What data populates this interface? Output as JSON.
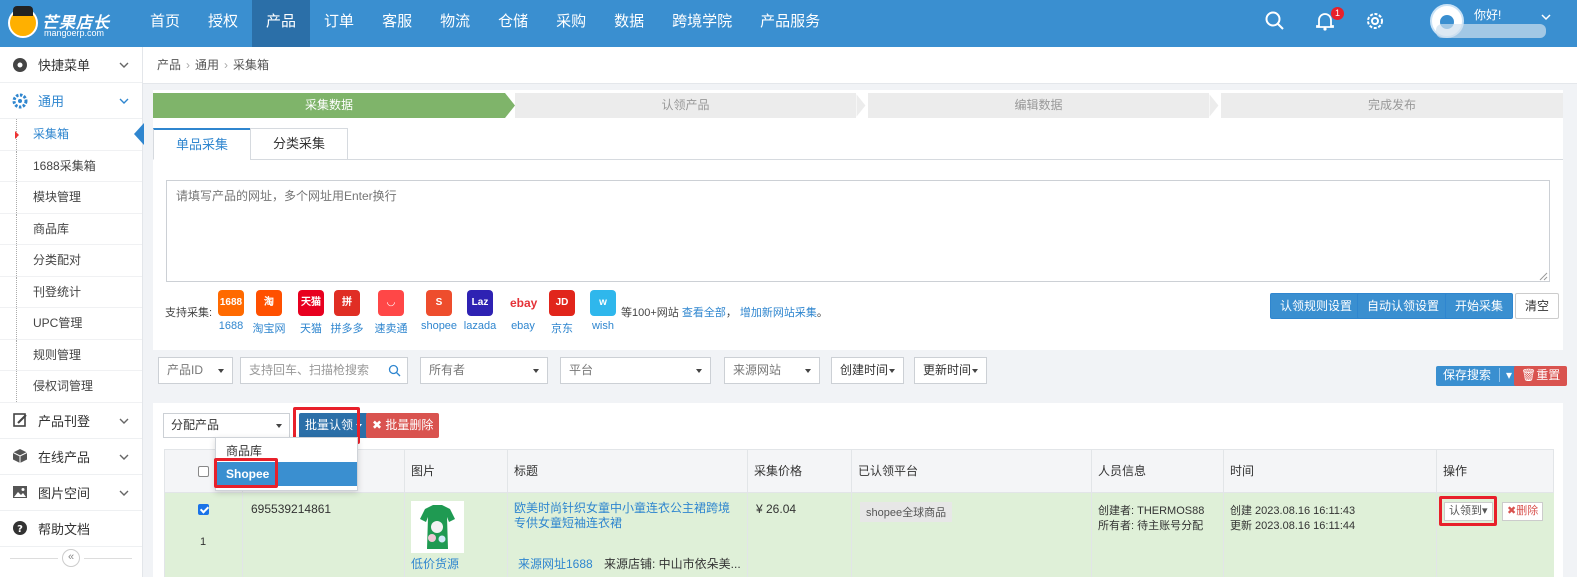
{
  "brand": {
    "name": "芒果店长",
    "domain": "mangoerp.com"
  },
  "nav": [
    {
      "label": "首页",
      "active": false
    },
    {
      "label": "授权",
      "active": false
    },
    {
      "label": "产品",
      "active": true
    },
    {
      "label": "订单",
      "active": false
    },
    {
      "label": "客服",
      "active": false
    },
    {
      "label": "物流",
      "active": false
    },
    {
      "label": "仓储",
      "active": false
    },
    {
      "label": "采购",
      "active": false
    },
    {
      "label": "数据",
      "active": false
    },
    {
      "label": "跨境学院",
      "active": false
    },
    {
      "label": "产品服务",
      "active": false
    }
  ],
  "header": {
    "notification_count": "1",
    "greeting": "你好!"
  },
  "sidebar": {
    "sections_top": [
      {
        "label": "快捷菜单",
        "icon": "compass-icon"
      },
      {
        "label": "通用",
        "icon": "gear-icon"
      }
    ],
    "sub_items": [
      "采集箱",
      "1688采集箱",
      "模块管理",
      "商品库",
      "分类配对",
      "刊登统计",
      "UPC管理",
      "规则管理",
      "侵权词管理"
    ],
    "sections_bottom": [
      {
        "label": "产品刊登",
        "icon": "edit-icon"
      },
      {
        "label": "在线产品",
        "icon": "box-icon"
      },
      {
        "label": "图片空间",
        "icon": "image-icon"
      },
      {
        "label": "帮助文档",
        "icon": "help-icon"
      }
    ],
    "collapse_glyph": "«"
  },
  "breadcrumb": [
    "产品",
    "通用",
    "采集箱"
  ],
  "steps": [
    "采集数据",
    "认领产品",
    "编辑数据",
    "完成发布"
  ],
  "tabs": [
    "单品采集",
    "分类采集"
  ],
  "collect": {
    "placeholder": "请填写产品的网址，多个网址用Enter换行",
    "support_label": "支持采集:",
    "sites": [
      {
        "label": "1688",
        "color": "#ff6a00",
        "glyph": "1688"
      },
      {
        "label": "淘宝网",
        "color": "#ff5000",
        "glyph": "淘"
      },
      {
        "label": "天猫",
        "color": "#e8001f",
        "glyph": "天猫"
      },
      {
        "label": "拼多多",
        "color": "#e02e24",
        "glyph": "拼"
      },
      {
        "label": "速卖通",
        "color": "#ff4747",
        "glyph": "◡"
      },
      {
        "label": "shopee",
        "color": "#ee4d2d",
        "glyph": "S"
      },
      {
        "label": "lazada",
        "color": "#2e22b3",
        "glyph": "Laz"
      },
      {
        "label": "ebay",
        "color": "#ffffff",
        "glyph": "ebay"
      },
      {
        "label": "京东",
        "color": "#e1251b",
        "glyph": "JD"
      },
      {
        "label": "wish",
        "color": "#2fb7ec",
        "glyph": "w"
      }
    ],
    "more_text": "等100+网站",
    "view_all": "查看全部",
    "sep": "，",
    "add_site": "增加新网站采集",
    "end": "。",
    "buttons": {
      "rules": "认领规则设置",
      "auto": "自动认领设置",
      "start": "开始采集",
      "clear": "清空"
    }
  },
  "filters": {
    "product_id": "产品ID",
    "search_placeholder": "支持回车、扫描枪搜索",
    "owner": "所有者",
    "platform": "平台",
    "source": "来源网站",
    "created": "创建时间",
    "updated": "更新时间",
    "save_search": "保存搜索",
    "reset": "重置"
  },
  "actions": {
    "assign": "分配产品",
    "batch_claim": "批量认领",
    "batch_delete": "批量删除",
    "dropdown": [
      "商品库",
      "Shopee"
    ]
  },
  "table": {
    "headers": [
      "图片",
      "标题",
      "采集价格",
      "已认领平台",
      "人员信息",
      "时间",
      "操作"
    ],
    "row": {
      "checked": true,
      "index": "1",
      "id": "695539214861",
      "image_caption": "低价货源",
      "title": "欧美时尚针织女童中小童连衣公主裙跨境专供女童短袖连衣裙",
      "source_link": "来源网址1688",
      "store": "来源店铺: 中山市依朵美...",
      "price": "¥ 26.04",
      "claimed_platform": "shopee全球商品",
      "creator": "创建者:  THERMOS88",
      "owner": "所有者:  待主账号分配",
      "created_time": "创建 2023.08.16 16:11:43",
      "updated_time": "更新 2023.08.16 16:11:44",
      "claim_to": "认领到",
      "delete": "删除"
    }
  },
  "colors": {
    "brand_blue": "#3a8fd0",
    "step_green": "#7fb46a",
    "row_highlight": "#dff0d8",
    "annotation_red": "#e8202a"
  }
}
